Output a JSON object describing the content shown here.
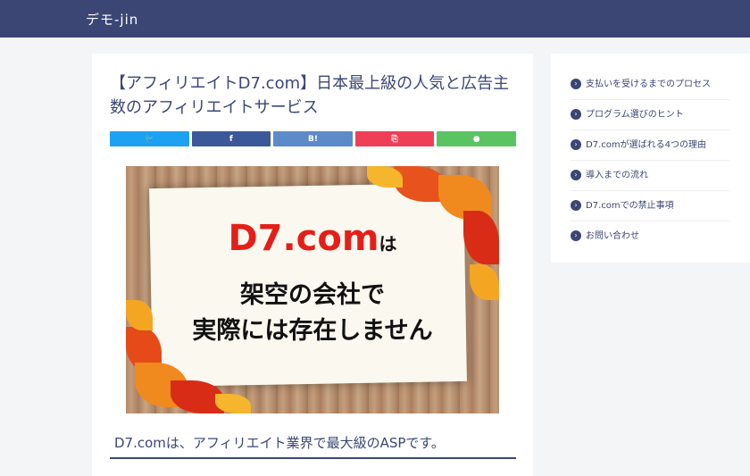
{
  "header": {
    "site_title": "デモ-jin"
  },
  "post": {
    "title": "【アフィリエイトD7.com】日本最上級の人気と広告主数のアフィリエイトサービス",
    "lead": "D7.comは、アフィリエイト業界で最大級のASPです。"
  },
  "share": [
    {
      "name": "twitter",
      "label": "🐦",
      "color": "#1da1f2"
    },
    {
      "name": "facebook",
      "label": "f",
      "color": "#3b5998"
    },
    {
      "name": "hatena",
      "label": "B!",
      "color": "#5d8ac9"
    },
    {
      "name": "pocket",
      "label": "⎘",
      "color": "#ef3f56"
    },
    {
      "name": "line",
      "label": "●",
      "color": "#5ac463"
    }
  ],
  "hero": {
    "line1_main": "D7.com",
    "line1_suffix": "は",
    "line2": "架空の会社で",
    "line3": "実際には存在しません"
  },
  "sidebar": {
    "items": [
      {
        "label": "支払いを受けるまでのプロセス"
      },
      {
        "label": "プログラム選びのヒント"
      },
      {
        "label": "D7.comが選ばれる4つの理由"
      },
      {
        "label": "導入までの流れ"
      },
      {
        "label": "D7.comでの禁止事項"
      },
      {
        "label": "お問い合わせ"
      }
    ]
  },
  "colors": {
    "header": "#3b4675",
    "accent_red": "#e41f18"
  }
}
